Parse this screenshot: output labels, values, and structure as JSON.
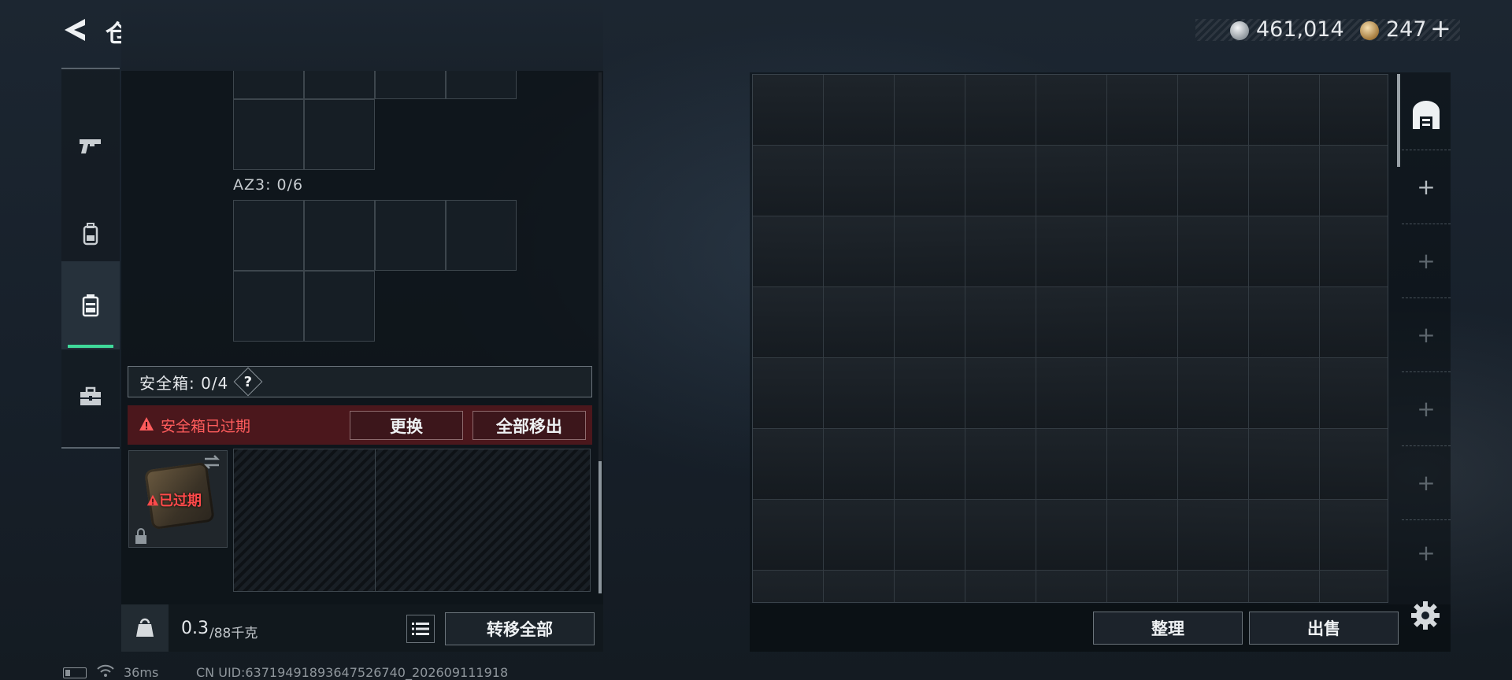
{
  "header": {
    "title": "仓库",
    "silver_amount": "461,014",
    "gold_amount": "247",
    "gold_plus": "+"
  },
  "tabs": [
    {
      "icon": "pistol-icon",
      "active": false
    },
    {
      "icon": "backpack-icon",
      "active": false
    },
    {
      "icon": "safebox-tab-icon",
      "active": true
    },
    {
      "icon": "toolbox-icon",
      "active": false
    }
  ],
  "container": {
    "az3_label": "AZ3: 0/6"
  },
  "safebox": {
    "label": "安全箱: 0/4",
    "help": "?",
    "expired_warning": "安全箱已过期",
    "replace_label": "更换",
    "remove_all_label": "全部移出",
    "item_badge": "已过期"
  },
  "footer": {
    "weight_current": "0.3",
    "weight_max": "/88千克",
    "transfer_all_label": "转移全部"
  },
  "warehouse": {
    "arrange_label": "整理",
    "sell_label": "出售",
    "add_slots": [
      "+",
      "+",
      "+",
      "+",
      "+",
      "+"
    ]
  },
  "status": {
    "ping": "36ms",
    "uid": "CN UID:63719491893647526740_202609111918"
  },
  "colors": {
    "accent_green": "#3fd99a",
    "warning_red": "#ff5c5c",
    "expired_bg": "#60181e"
  }
}
